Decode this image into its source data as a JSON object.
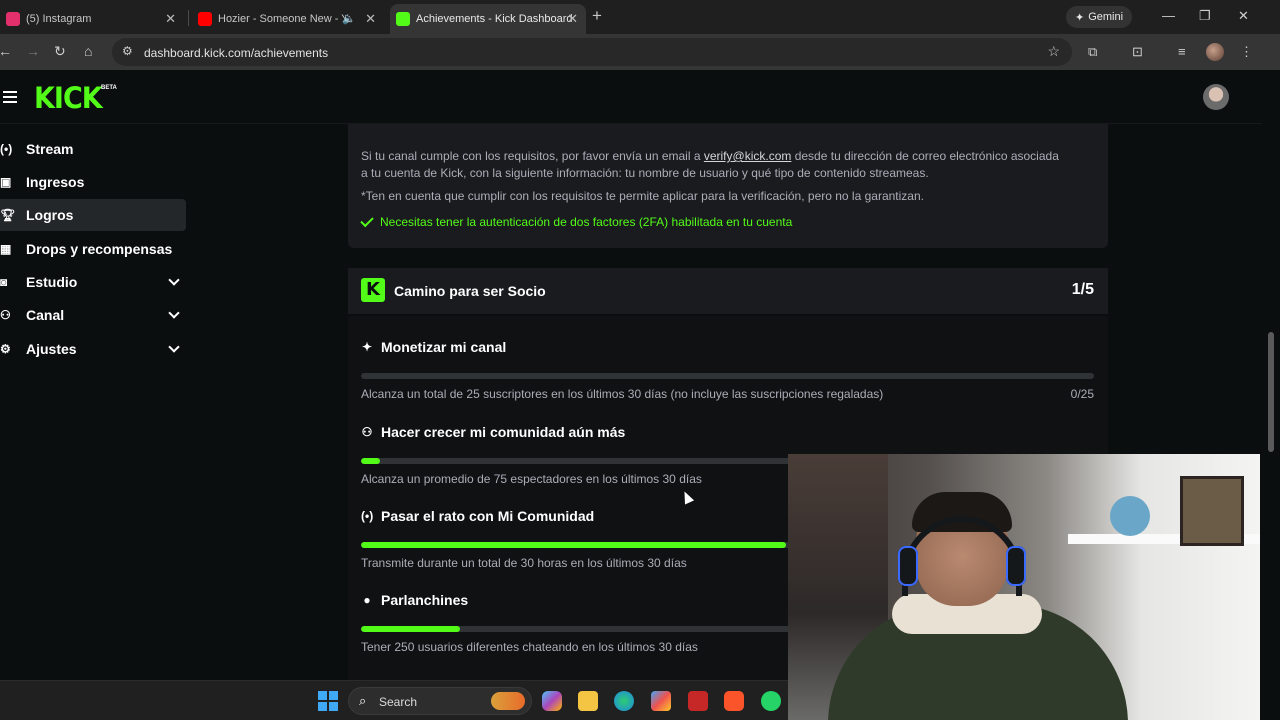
{
  "browser": {
    "tabs": [
      {
        "label": "(5) Instagram",
        "icon": "instagram-icon",
        "color": "#e1306c"
      },
      {
        "label": "Hozier - Someone New - Yo",
        "icon": "youtube-icon",
        "color": "#ff0000"
      },
      {
        "label": "Achievements - Kick Dashboard",
        "icon": "kick-icon",
        "color": "#53fc18"
      }
    ],
    "gemini_label": "Gemini",
    "url": "dashboard.kick.com/achievements"
  },
  "header": {
    "logo": "KICK",
    "beta": "BETA"
  },
  "sidebar": {
    "items": [
      {
        "label": "Stream",
        "icon": "broadcast-icon"
      },
      {
        "label": "Ingresos",
        "icon": "chart-icon"
      },
      {
        "label": "Logros",
        "icon": "trophy-icon"
      },
      {
        "label": "Drops y recompensas",
        "icon": "gift-icon"
      },
      {
        "label": "Estudio",
        "icon": "camera-icon"
      },
      {
        "label": "Canal",
        "icon": "users-icon"
      },
      {
        "label": "Ajustes",
        "icon": "gear-icon"
      }
    ]
  },
  "verification": {
    "text_pre": "Si tu canal cumple con los requisitos, por favor envía un email a ",
    "email": "verify@kick.com",
    "text_post": " desde tu dirección de correo electrónico asociada",
    "text_line2": "a tu cuenta de Kick, con la siguiente información: tu nombre de usuario y qué tipo de contenido streameas.",
    "note": "*Ten en cuenta que cumplir con los requisitos te permite aplicar para la verificación, pero no la garantizan.",
    "requirement": "Necesitas tener la autenticación de dos factores (2FA) habilitada en tu cuenta"
  },
  "partner_path": {
    "title": "Camino para ser Socio",
    "count": "1/5",
    "achievements": [
      {
        "title": "Monetizar mi canal",
        "icon": "sparkle-icon",
        "desc": "Alcanza un total de 25 suscriptores en los últimos 30 días (no incluye las suscripciones regaladas)",
        "count": "0/25",
        "progress": 0.0
      },
      {
        "title": "Hacer crecer mi comunidad aún más",
        "icon": "community-icon",
        "desc": "Alcanza un promedio de 75 espectadores en los últimos 30 días",
        "count": "",
        "progress": 0.026
      },
      {
        "title": "Pasar el rato con Mi Comunidad",
        "icon": "broadcast-icon",
        "desc": "Transmite durante un total de 30 horas en los últimos 30 días",
        "count": "",
        "progress": 0.58
      },
      {
        "title": "Parlanchines",
        "icon": "chat-icon",
        "desc": "Tener 250 usuarios diferentes chateando en los últimos 30 días",
        "count": "",
        "progress": 0.135
      }
    ]
  },
  "taskbar": {
    "search_label": "Search"
  }
}
